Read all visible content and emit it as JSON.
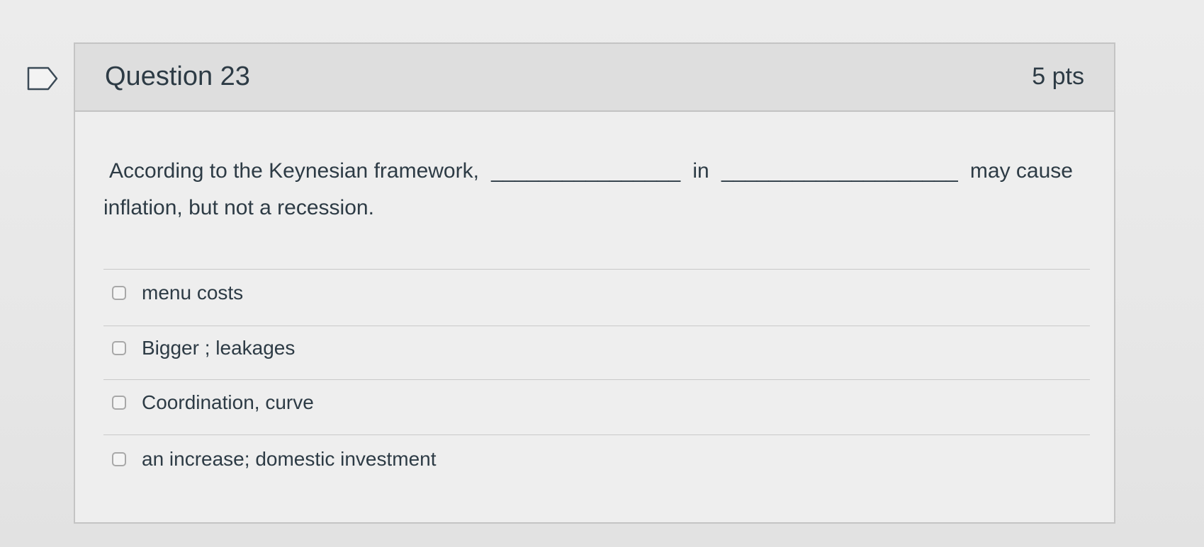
{
  "question": {
    "title": "Question 23",
    "points": "5 pts",
    "text_part1": "According to the Keynesian framework,",
    "blank1": "________________",
    "text_part2": "in",
    "blank2": "____________________",
    "text_part3": "may cause",
    "text_line2": "inflation, but not a recession."
  },
  "answers": [
    {
      "label": "menu costs",
      "checked": false
    },
    {
      "label": "Bigger ; leakages",
      "checked": false
    },
    {
      "label": "Coordination, curve",
      "checked": false
    },
    {
      "label": "an increase; domestic investment",
      "checked": false
    }
  ],
  "icons": {
    "flag": "bookmark-flag-icon",
    "checkbox": "checkbox-icon"
  },
  "colors": {
    "text": "#2d3b45",
    "header_bg": "#dedede",
    "border": "#c4c4c4"
  }
}
